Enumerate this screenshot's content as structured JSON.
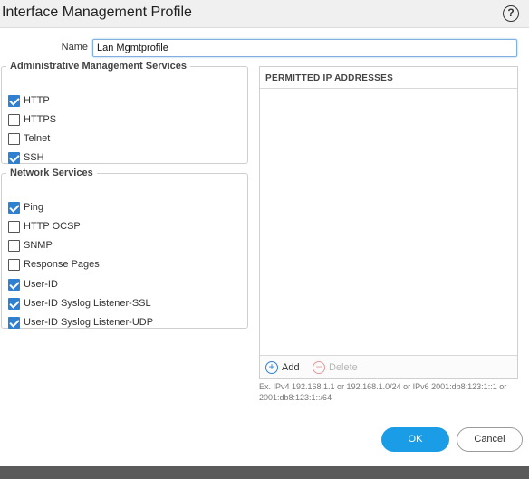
{
  "dialog": {
    "title": "Interface Management Profile",
    "help_glyph": "?"
  },
  "name_field": {
    "label": "Name",
    "value": "Lan Mgmtprofile"
  },
  "admin_services": {
    "legend": "Administrative Management Services",
    "items": [
      {
        "label": "HTTP",
        "checked": true
      },
      {
        "label": "HTTPS",
        "checked": false
      },
      {
        "label": "Telnet",
        "checked": false
      },
      {
        "label": "SSH",
        "checked": true
      }
    ]
  },
  "network_services": {
    "legend": "Network Services",
    "items": [
      {
        "label": "Ping",
        "checked": true
      },
      {
        "label": "HTTP OCSP",
        "checked": false
      },
      {
        "label": "SNMP",
        "checked": false
      },
      {
        "label": "Response Pages",
        "checked": false
      },
      {
        "label": "User-ID",
        "checked": true
      },
      {
        "label": "User-ID Syslog Listener-SSL",
        "checked": true
      },
      {
        "label": "User-ID Syslog Listener-UDP",
        "checked": true
      }
    ]
  },
  "permitted_ip": {
    "header": "PERMITTED IP ADDRESSES",
    "rows": [],
    "add_label": "Add",
    "add_glyph": "+",
    "delete_label": "Delete",
    "delete_glyph": "−",
    "hint": "Ex. IPv4 192.168.1.1 or 192.168.1.0/24 or IPv6 2001:db8:123:1::1 or 2001:db8:123:1::/64"
  },
  "footer": {
    "ok_label": "OK",
    "cancel_label": "Cancel"
  },
  "colors": {
    "accent": "#1a9de6",
    "checkbox": "#2f80d1"
  },
  "icons": {
    "help": "help-icon",
    "add": "add-circle-icon",
    "delete": "delete-circle-icon"
  }
}
